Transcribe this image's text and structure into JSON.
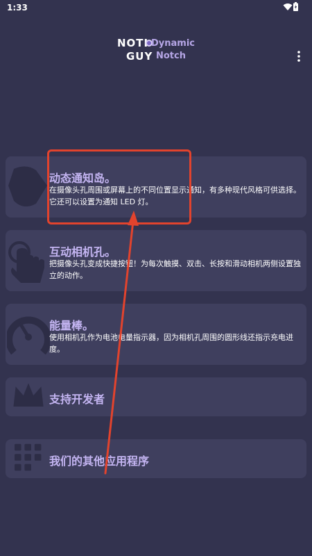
{
  "status_bar": {
    "time": "1:33"
  },
  "logo": {
    "noti": "NOTI",
    "guy": "GUY",
    "dynamic": "Dynamic",
    "notch": "Notch"
  },
  "cards": [
    {
      "title": "动态通知岛。",
      "desc": "在摄像头孔周围或屏幕上的不同位置显示通知，有多种现代风格可供选择。它还可以设置为通知 LED 灯。"
    },
    {
      "title": "互动相机孔。",
      "desc": "把摄像头孔变成快捷按钮！为每次触摸、双击、长按和滑动相机两侧设置独立的动作。"
    },
    {
      "title": "能量棒。",
      "desc": "使用相机孔作为电池电量指示器，因为相机孔周围的圆形线还指示充电进度。"
    },
    {
      "title": "支持开发者"
    },
    {
      "title": "我们的其他应用程序"
    }
  ],
  "colors": {
    "background": "#33334f",
    "card": "#3f3f5e",
    "accent": "#c4b5f2",
    "annotation": "#e2432d"
  },
  "icons": [
    "wifi-icon",
    "battery-icon",
    "overflow-menu-icon",
    "notch-shape-icon",
    "touch-hand-icon",
    "gauge-icon",
    "crown-icon",
    "grid-apps-icon"
  ]
}
